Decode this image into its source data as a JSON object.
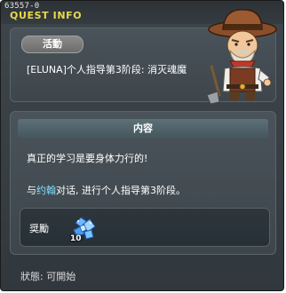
{
  "window": {
    "id": "63557-0",
    "title": "QUEST INFO"
  },
  "activity": {
    "badge": "活動",
    "quest_name": "[ELUNA]个人指导第3阶段: 消灭魂魔"
  },
  "content": {
    "header": "内容",
    "line1": "真正的学习是要身体力行的!",
    "line2_prefix": "与",
    "line2_npc": "约翰",
    "line2_suffix": "对话, 进行个人指导第3阶段。"
  },
  "reward": {
    "label": "奨勵",
    "item_icon": "blue-crystal-icon",
    "quantity": "10"
  },
  "status": {
    "text": "狀態: 可開始"
  },
  "npc": {
    "icon": "cowboy-npc-portrait"
  },
  "colors": {
    "title": "#e8d94a",
    "npc_highlight": "#7fe0ff",
    "panel_bg": "#3e464c"
  }
}
